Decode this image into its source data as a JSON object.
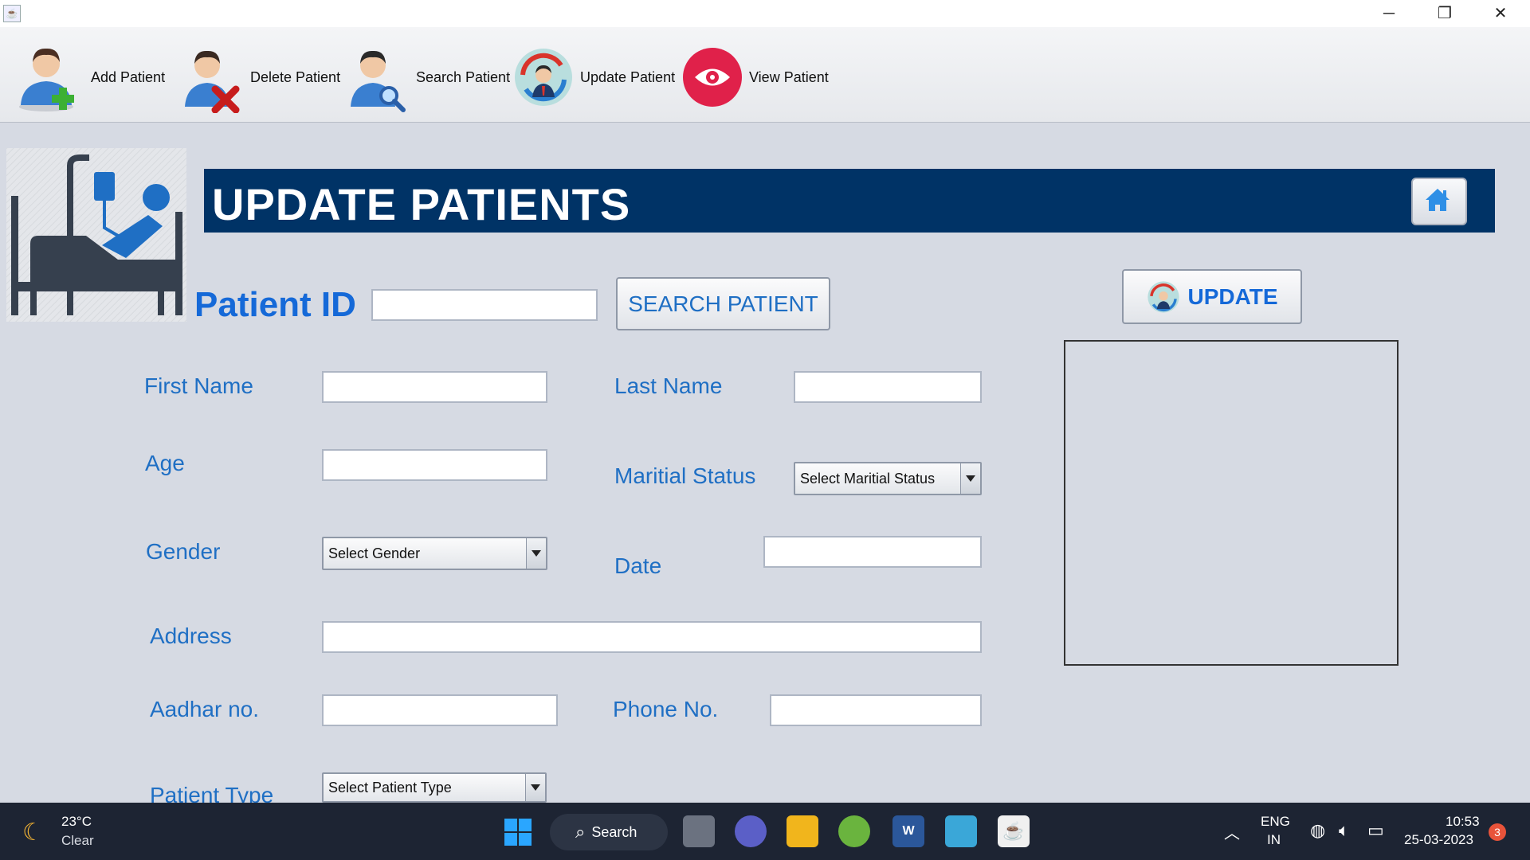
{
  "window": {
    "minimize_symbol": "─",
    "restore_symbol": "❐",
    "close_symbol": "✕"
  },
  "toolbar": {
    "items": [
      {
        "label": "Add Patient",
        "icon": "add-user-icon"
      },
      {
        "label": "Delete Patient",
        "icon": "delete-user-icon"
      },
      {
        "label": "Search Patient",
        "icon": "search-user-icon"
      },
      {
        "label": "Update Patient",
        "icon": "update-user-icon"
      },
      {
        "label": "View Patient",
        "icon": "eye-icon"
      }
    ]
  },
  "header": {
    "title": "UPDATE PATIENTS",
    "home_icon": "home-icon",
    "band_color": "#003366"
  },
  "search": {
    "label": "Patient ID",
    "value": "",
    "button_label": "SEARCH PATIENT"
  },
  "update_button": {
    "label": "UPDATE",
    "icon": "update-user-icon"
  },
  "form": {
    "first_name": {
      "label": "First Name",
      "value": ""
    },
    "last_name": {
      "label": "Last Name",
      "value": ""
    },
    "age": {
      "label": "Age",
      "value": ""
    },
    "marital_status": {
      "label": "Maritial Status",
      "selected": "Select Maritial Status"
    },
    "gender": {
      "label": "Gender",
      "selected": "Select Gender"
    },
    "date": {
      "label": "Date",
      "value": ""
    },
    "address": {
      "label": "Address",
      "value": ""
    },
    "aadhar": {
      "label": "Aadhar no.",
      "value": ""
    },
    "phone": {
      "label": "Phone No.",
      "value": ""
    },
    "patient_type": {
      "label": "Patient Type",
      "selected": "Select Patient Type"
    }
  },
  "colors": {
    "label_blue": "#1f6fc4",
    "background": "#d6dae3"
  },
  "taskbar": {
    "weather_temp": "23°C",
    "weather_desc": "Clear",
    "search_label": "Search",
    "lang_top": "ENG",
    "lang_bottom": "IN",
    "time": "10:53",
    "date": "25-03-2023",
    "notification_count": "3"
  }
}
